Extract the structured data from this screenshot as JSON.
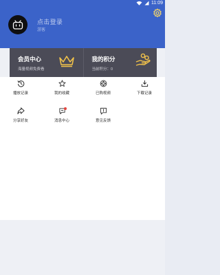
{
  "status_bar": {
    "time": "11:09"
  },
  "profile": {
    "login_prompt": "点击登录",
    "user_type": "游客"
  },
  "cards": [
    {
      "title": "会员中心",
      "subtitle": "海量视频免费看"
    },
    {
      "title": "我的积分",
      "subtitle": "当前积分：0"
    }
  ],
  "menu": [
    {
      "label": "播放记录",
      "icon": "history-icon"
    },
    {
      "label": "我的收藏",
      "icon": "star-icon"
    },
    {
      "label": "已购视频",
      "icon": "film-reel-icon"
    },
    {
      "label": "下载记录",
      "icon": "download-icon"
    },
    {
      "label": "分享好友",
      "icon": "share-icon"
    },
    {
      "label": "消息中心",
      "icon": "message-icon"
    },
    {
      "label": "意见反馈",
      "icon": "feedback-icon"
    }
  ],
  "colors": {
    "header": "#3b63c9",
    "card_bg": "#4b4b57",
    "crown": "#f1c24a",
    "badge": "#e2463f"
  }
}
